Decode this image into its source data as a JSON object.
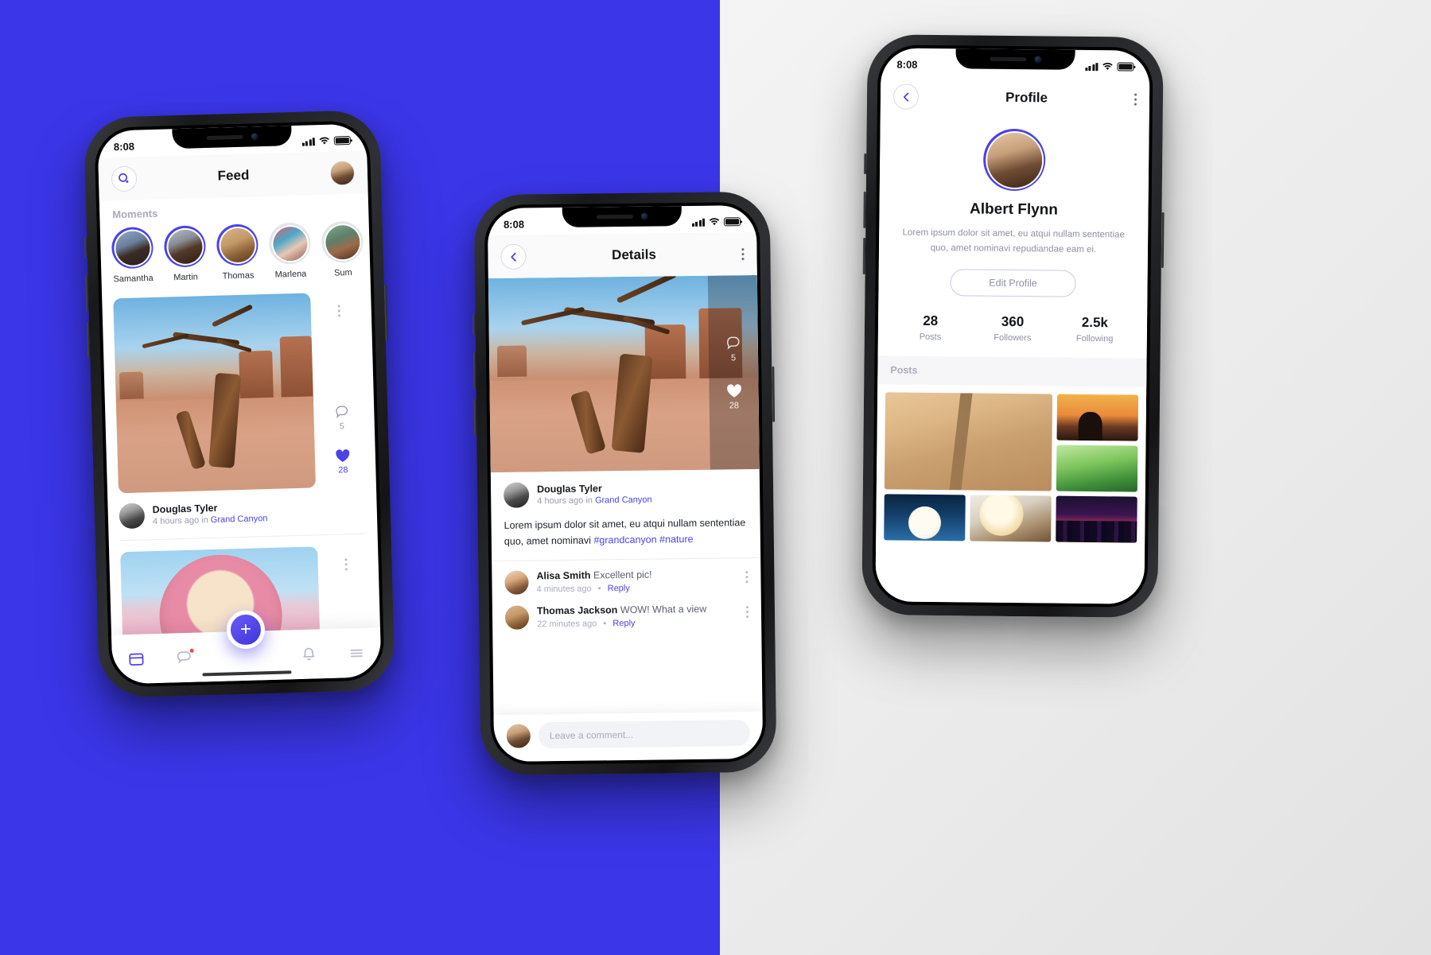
{
  "brand": {
    "accent": "#4b42e8",
    "bg_left": "#3b36e8",
    "bg_right": "#ececec"
  },
  "feed_screen": {
    "status": {
      "time": "8:08",
      "signal_icon": "cellular-signal-icon",
      "wifi_icon": "wifi-icon",
      "battery_icon": "battery-icon"
    },
    "navbar": {
      "search_icon": "search-icon",
      "title": "Feed",
      "avatar_name": "profile-avatar"
    },
    "moments": {
      "label": "Moments",
      "items": [
        {
          "name": "Samantha",
          "seen": false
        },
        {
          "name": "Martin",
          "seen": false
        },
        {
          "name": "Thomas",
          "seen": false
        },
        {
          "name": "Marlena",
          "seen": true
        },
        {
          "name": "Sum",
          "seen": true
        }
      ]
    },
    "posts": [
      {
        "image": "grand-canyon-dead-tree",
        "comments_count": "5",
        "likes_count": "28",
        "liked": true,
        "author": "Douglas Tyler",
        "meta_prefix": "4 hours ago in ",
        "meta_place": "Grand Canyon",
        "menu_icon": "kebab-menu-icon",
        "comment_icon": "comment-icon",
        "like_icon": "heart-icon"
      },
      {
        "image": "donut-pink-sprinkles",
        "menu_icon": "kebab-menu-icon"
      }
    ],
    "tabbar": {
      "items": [
        {
          "icon": "feed-card-icon",
          "name": "tab-feed",
          "active": true,
          "badge": false
        },
        {
          "icon": "messages-icon",
          "name": "tab-messages",
          "active": false,
          "badge": true
        },
        {
          "icon": "notifications-bell-icon",
          "name": "tab-notifications",
          "active": false,
          "badge": false
        },
        {
          "icon": "menu-hamburger-icon",
          "name": "tab-menu",
          "active": false,
          "badge": false
        }
      ],
      "fab_label": "+",
      "fab_icon": "add-post-icon"
    }
  },
  "details_screen": {
    "status": {
      "time": "8:08"
    },
    "navbar": {
      "back_icon": "chevron-left-icon",
      "title": "Details",
      "menu_icon": "kebab-menu-icon"
    },
    "photo": {
      "image": "grand-canyon-dead-tree",
      "comments_count": "5",
      "likes_count": "28",
      "comment_icon": "comment-icon",
      "like_icon": "heart-icon"
    },
    "author": "Douglas Tyler",
    "meta_prefix": "4 hours ago in ",
    "meta_place": "Grand Canyon",
    "caption_text": "Lorem ipsum dolor sit amet, eu atqui nullam sententiae quo, amet nominavi ",
    "caption_tags": "#grandcanyon #nature",
    "comments": [
      {
        "name": "Alisa Smith",
        "text": " Excellent pic!",
        "time": "4 minutes ago",
        "sep": "•",
        "reply": "Reply",
        "menu_icon": "kebab-menu-icon"
      },
      {
        "name": "Thomas Jackson",
        "text": " WOW! What a view",
        "time": "22 minutes ago",
        "sep": "•",
        "reply": "Reply",
        "menu_icon": "kebab-menu-icon"
      }
    ],
    "composer": {
      "placeholder": "Leave a comment...",
      "avatar_name": "composer-avatar"
    }
  },
  "profile_screen": {
    "status": {
      "time": "8:08"
    },
    "navbar": {
      "back_icon": "chevron-left-icon",
      "title": "Profile",
      "menu_icon": "kebab-menu-icon"
    },
    "avatar_name": "profile-large-avatar",
    "name": "Albert Flynn",
    "bio_line1": "Lorem ipsum dolor sit amet, eu atqui nullam sententiae",
    "bio_line2": "quo, amet nominavi repudiandae eam ei.",
    "edit_label": "Edit Profile",
    "stats": [
      {
        "value": "28",
        "label": "Posts"
      },
      {
        "value": "360",
        "label": "Followers"
      },
      {
        "value": "2.5k",
        "label": "Following"
      }
    ],
    "posts_label": "Posts",
    "grid": [
      {
        "name": "post-thumb-desert-road",
        "style": "ph-dune"
      },
      {
        "name": "post-thumb-sunset-person",
        "style": "ph-sunset"
      },
      {
        "name": "post-thumb-green-field",
        "style": "ph-field"
      },
      {
        "name": "post-thumb-moon",
        "style": "ph-moon"
      },
      {
        "name": "post-thumb-breakfast",
        "style": "ph-food"
      },
      {
        "name": "post-thumb-city-night",
        "style": "ph-city"
      }
    ]
  }
}
